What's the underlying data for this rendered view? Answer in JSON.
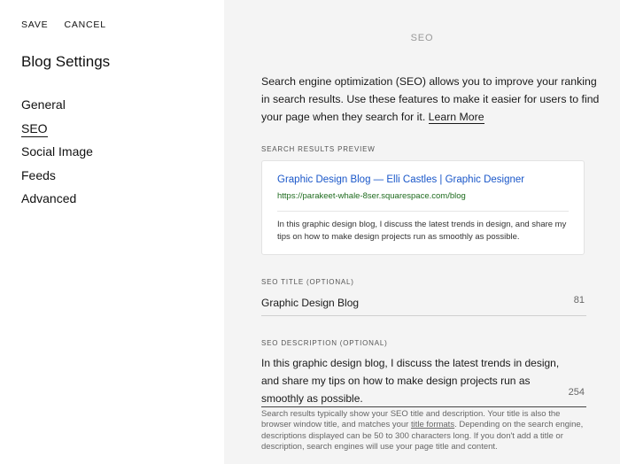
{
  "sidebar": {
    "save_label": "SAVE",
    "cancel_label": "CANCEL",
    "title": "Blog Settings",
    "nav": [
      {
        "label": "General"
      },
      {
        "label": "SEO",
        "active": true
      },
      {
        "label": "Social Image"
      },
      {
        "label": "Feeds"
      },
      {
        "label": "Advanced"
      }
    ]
  },
  "main": {
    "header": "SEO",
    "intro_text": "Search engine optimization (SEO) allows you to improve your ranking in search results. Use these features to make it easier for users to find your page when they search for it.",
    "learn_more_label": "Learn More",
    "preview": {
      "label": "SEARCH RESULTS PREVIEW",
      "title": "Graphic Design Blog — Elli Castles | Graphic Designer",
      "url": "https://parakeet-whale-8ser.squarespace.com/blog",
      "description": "In this graphic design blog, I discuss the latest trends in design, and share my tips on how to make design projects run as smoothly as possible."
    },
    "seo_title": {
      "label": "SEO TITLE (OPTIONAL)",
      "value": "Graphic Design Blog",
      "count": "81"
    },
    "seo_description": {
      "label": "SEO DESCRIPTION (OPTIONAL)",
      "value": "In this graphic design blog, I discuss the latest  trends in design, and share my tips on how to make design projects run as smoothly as possible.",
      "count": "254"
    },
    "help": {
      "before_link": "Search results typically show your SEO title and description. Your title is also the browser window title, and matches your",
      "link_label": "title formats",
      "after_link": ". Depending on the search engine, descriptions displayed can be 50 to 300 characters long. If you don't add a title or description, search engines will use your page title and content."
    }
  }
}
